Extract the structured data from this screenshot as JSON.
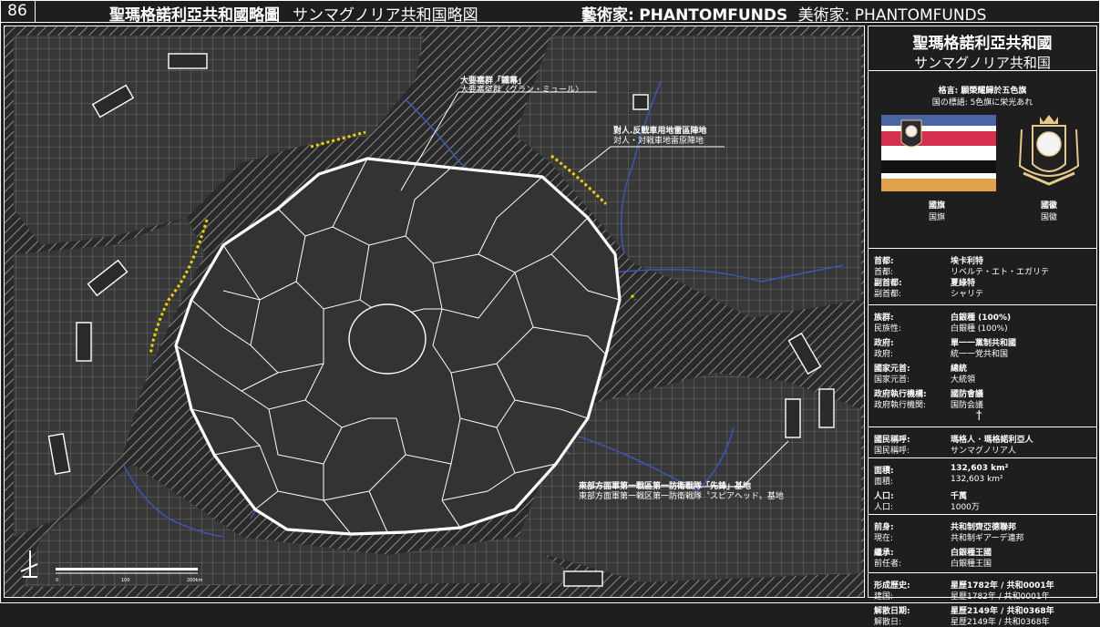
{
  "header": {
    "page_number": "86",
    "title": "聖瑪格諾利亞共和國略圖",
    "title_sub": "サンマグノリア共和国略図",
    "artist_label": "藝術家:",
    "artist_name": "PHANTOMFUNDS",
    "artist_sub": "美術家: PHANTOMFUNDS"
  },
  "map": {
    "labels": [
      {
        "main": "大要塞群「鐵幕」",
        "sub": "大要塞壁群〈グラン・ミュール〉"
      },
      {
        "main": "對人.反戰車用地雷區陣地",
        "sub": "対人・対戦車地雷原陣地"
      },
      {
        "main": "東部方面軍第一戰區第一防衛戰隊「先鋒」基地",
        "sub": "東部方面軍第一戦区第一防衛戦隊〝スピアヘッド〟基地"
      }
    ],
    "scale_ticks": [
      "0",
      "100",
      "200km"
    ],
    "colors": {
      "land": "#333333",
      "river": "#3b55b0",
      "border": "#ffffff",
      "minefield": "#f0d000"
    }
  },
  "panel": {
    "name_main": "聖瑪格諾利亞共和國",
    "name_sub": "サンマグノリア共和国",
    "motto_main": "格言: 願榮耀歸於五色旗",
    "motto_sub": "国の標語: 5色旗に栄光あれ",
    "flag_label_main": "國旗",
    "flag_label_sub": "国旗",
    "coa_label_main": "國徽",
    "coa_label_sub": "国徽",
    "dagger": "†",
    "flag_colors": [
      "#4b64a6",
      "#ffffff",
      "#d42f4c",
      "#ffffff",
      "#111111",
      "#ffffff",
      "#e0a24a"
    ],
    "rows": [
      [
        {
          "k": "首都:",
          "v": "埃卡利特",
          "bold": true
        },
        {
          "k": "首都:",
          "v": "リベルテ・エト・エガリテ",
          "bold": false
        },
        {
          "k": "副首都:",
          "v": "夏綠特",
          "bold": true
        },
        {
          "k": "副首都:",
          "v": "シャリテ",
          "bold": false
        }
      ],
      [
        {
          "k": "族群:",
          "v": "白銀種 (100%)",
          "bold": true
        },
        {
          "k": "民族性:",
          "v": "白銀種 (100%)",
          "bold": false
        },
        {
          "k": "政府:",
          "v": "單一一黨制共和國",
          "bold": true
        },
        {
          "k": "政府:",
          "v": "統一一党共和国",
          "bold": false
        },
        {
          "k": "國家元首:",
          "v": "總統",
          "bold": true
        },
        {
          "k": "国家元首:",
          "v": "大統領",
          "bold": false
        },
        {
          "k": "政府執行機構:",
          "v": "國防會議",
          "bold": true
        },
        {
          "k": "政府執行機関:",
          "v": "国防会議",
          "bold": false
        }
      ],
      [
        {
          "k": "國民稱呼:",
          "v": "瑪格人 · 瑪格諾利亞人",
          "bold": true
        },
        {
          "k": "国民稱呼:",
          "v": "サンマグノリア人",
          "bold": false
        }
      ],
      [
        {
          "k": "面積:",
          "v": "132,603 km²",
          "bold": true
        },
        {
          "k": "面積:",
          "v": "132,603 km²",
          "bold": false
        },
        {
          "k": "人口:",
          "v": "千萬",
          "bold": true
        },
        {
          "k": "人口:",
          "v": "1000万",
          "bold": false
        }
      ],
      [
        {
          "k": "前身:",
          "v": "共和制齊亞德聯邦",
          "bold": true
        },
        {
          "k": "現在:",
          "v": "共和制ギアーデ連邦",
          "bold": false
        },
        {
          "k": "繼承:",
          "v": "白銀種王國",
          "bold": true
        },
        {
          "k": "前任者:",
          "v": "白銀種王国",
          "bold": false
        }
      ],
      [
        {
          "k": "形成歷史:",
          "v": "星歷1782年 / 共和0001年",
          "bold": true
        },
        {
          "k": "建国:",
          "v": "星歴1782年 / 共和0001年",
          "bold": false
        },
        {
          "k": "解散日期:",
          "v": "星歷2149年 / 共和0368年",
          "bold": true
        },
        {
          "k": "解散日:",
          "v": "星歴2149年 / 共和0368年",
          "bold": false
        }
      ]
    ]
  }
}
